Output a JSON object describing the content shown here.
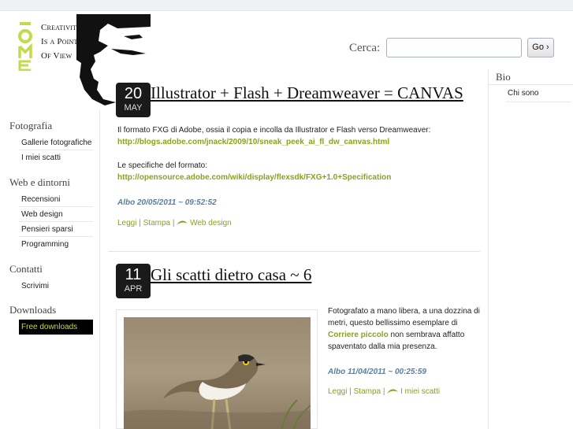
{
  "site": {
    "logo_text": [
      "Creativity",
      "Is a Point",
      "Of View"
    ],
    "logo_mark_text": "IOME"
  },
  "search": {
    "label": "Cerca:",
    "placeholder": "",
    "value": "",
    "button_label": "Go ›"
  },
  "sidebar": {
    "sections": [
      {
        "title": "Fotografia",
        "items": [
          "Gallerie fotografiche",
          "I miei scatti"
        ]
      },
      {
        "title": "Web e dintorni",
        "items": [
          "Recensioni",
          "Web design",
          "Pensieri sparsi",
          "Programming"
        ]
      },
      {
        "title": "Contatti",
        "items": [
          "Scrivimi"
        ]
      },
      {
        "title": "Downloads",
        "items": [
          "Free downloads"
        ]
      }
    ]
  },
  "right_sidebar": {
    "title": "Bio",
    "items": [
      "Chi sono"
    ]
  },
  "posts": [
    {
      "day": "20",
      "month": "MAY",
      "title": "Illustrator + Flash + Dreamweaver = CANVAS",
      "body_intro": "Il formato FXG di Adobe, ossia il copia e incolla da Illustrator e Flash verso Dreamweaver:",
      "link1": "http://blogs.adobe.com/jnack/2009/10/sneak_peek_ai_fl_dw_canvas.html",
      "body_spec": "Le specifiche del formato:",
      "link2": "http://opensource.adobe.com/wiki/display/flexsdk/FXG+1.0+Specification",
      "meta": "Albo  20/05/2011 ~ 09:52:52",
      "actions": {
        "read": "Leggi",
        "print": "Stampa",
        "category": "Web design"
      }
    },
    {
      "day": "11",
      "month": "APR",
      "title": "Gli scatti dietro casa ~ 6",
      "body_pre": "Fotografato a mano libera, a una dozzina di metri, questo bellissimo esemplare di",
      "body_link": "Corriere piccolo",
      "body_post": "non sembrava affatto spaventato dalla mia presenza.",
      "meta": "Albo  11/04/2011 ~ 00:25:59",
      "actions": {
        "read": "Leggi",
        "print": "Stampa",
        "category": "I miei scatti"
      }
    }
  ],
  "colors": {
    "accent": "#8aa21b",
    "logo_mark": "#c6d94a",
    "meta": "#5a7fa0",
    "badge": "#1a1a1a"
  }
}
